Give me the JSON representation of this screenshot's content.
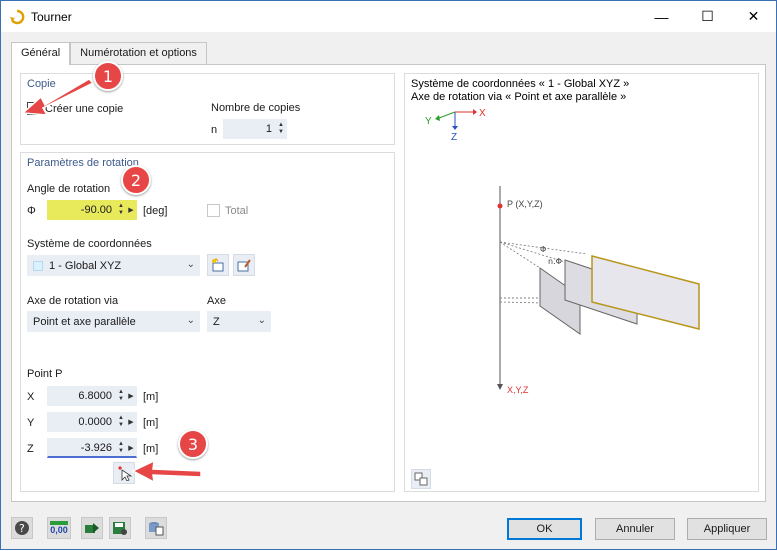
{
  "window": {
    "title": "Tourner",
    "minimize": "—",
    "maximize": "☐",
    "close": "✕"
  },
  "tabs": [
    {
      "label": "Général"
    },
    {
      "label": "Numérotation et options"
    }
  ],
  "copy": {
    "group_title": "Copie",
    "create_copy_label": "Créer une copie",
    "create_copy_checked": true,
    "num_copies_label": "Nombre de copies",
    "n_label": "n",
    "n_value": "1"
  },
  "rotation": {
    "group_title": "Paramètres de rotation",
    "angle_label": "Angle de rotation",
    "phi_symbol": "Φ",
    "angle_value": "-90.00",
    "angle_unit": "[deg]",
    "total_label": "Total",
    "coord_system_label": "Système de coordonnées",
    "coord_system_value": "1 - Global XYZ",
    "axis_via_label": "Axe de rotation via",
    "axis_via_value": "Point et axe parallèle",
    "axis_label": "Axe",
    "axis_value": "Z",
    "point_label": "Point P",
    "x_label": "X",
    "x_value": "6.8000",
    "x_unit": "[m]",
    "y_label": "Y",
    "y_value": "0.0000",
    "y_unit": "[m]",
    "z_label": "Z",
    "z_value": "-3.926",
    "z_unit": "[m]"
  },
  "preview": {
    "line1": "Système de coordonnées « 1 - Global XYZ »",
    "line2": "Axe de rotation via « Point et axe parallèle »",
    "axis_y": "Y",
    "axis_x": "X",
    "axis_z": "Z",
    "point_label": "P (X,Y,Z)",
    "bottom_label": "X,Y,Z",
    "phi_label": "Φ",
    "nphi_label": "n.Φ"
  },
  "callouts": [
    "1",
    "2",
    "3"
  ],
  "buttons": {
    "ok": "OK",
    "cancel": "Annuler",
    "apply": "Appliquer"
  },
  "footer": {
    "units_icon_text": "0,00"
  },
  "colors": {
    "accent_blue": "#0078d7",
    "highlight_yellow": "#e8ea5c",
    "callout_red": "#e64646",
    "group_title": "#3d5a8c"
  }
}
